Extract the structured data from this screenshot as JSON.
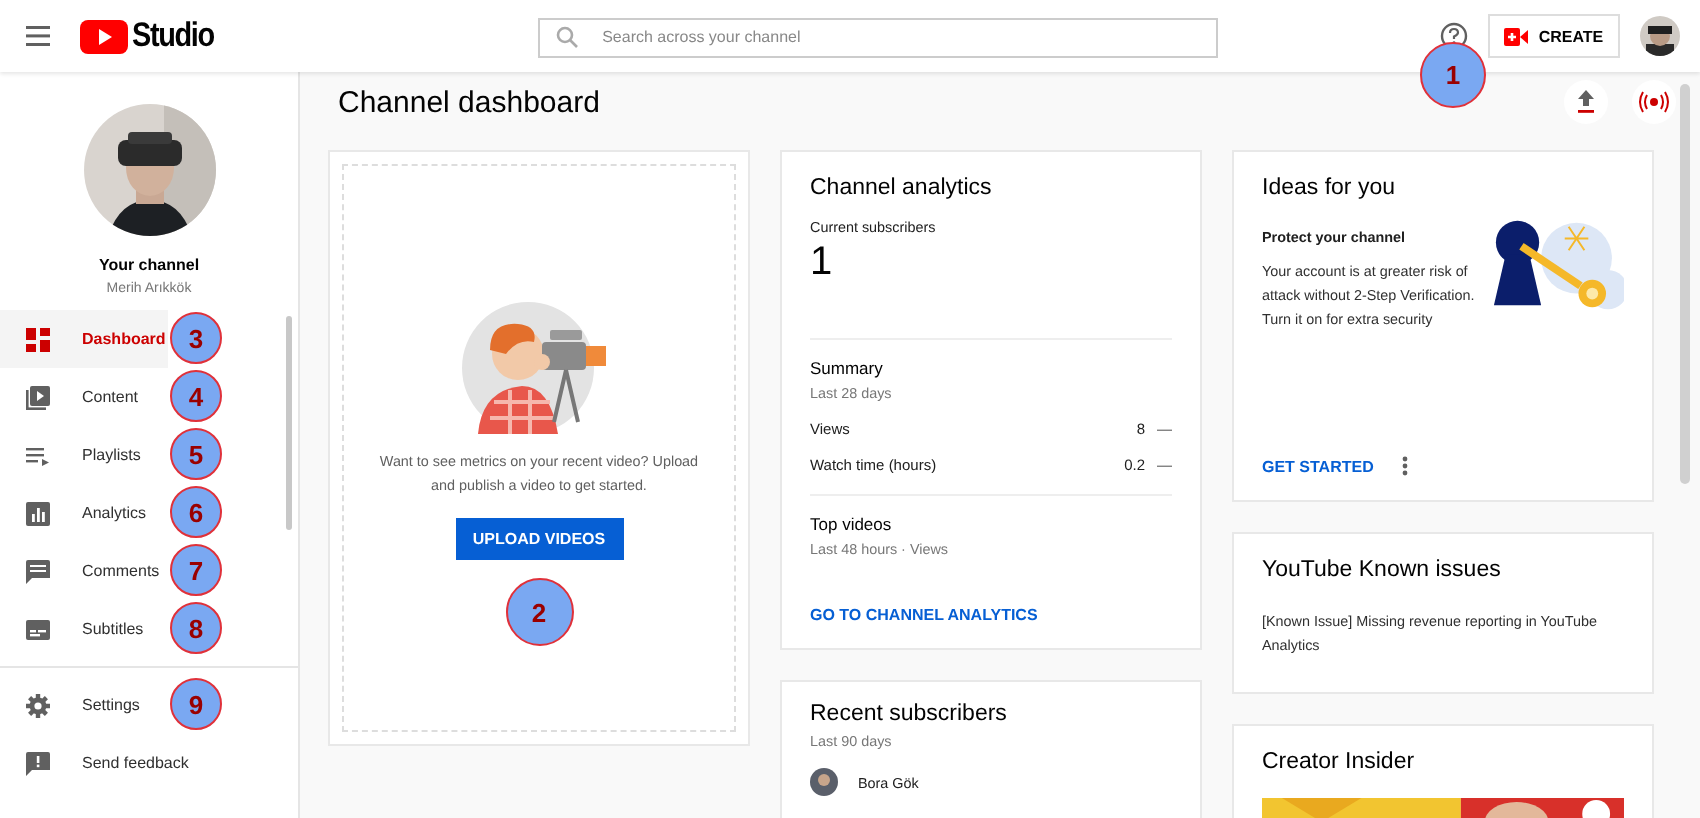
{
  "header": {
    "logo_text": "Studio",
    "search_placeholder": "Search across your channel",
    "help_marker": "1",
    "create_label": "CREATE"
  },
  "sidebar": {
    "channel_title": "Your channel",
    "channel_name": "Merih Arıkkök",
    "items": [
      {
        "kind": "dashboard",
        "label": "Dashboard",
        "selected": true,
        "marker": "3"
      },
      {
        "kind": "content",
        "label": "Content",
        "selected": false,
        "marker": "4"
      },
      {
        "kind": "playlists",
        "label": "Playlists",
        "selected": false,
        "marker": "5"
      },
      {
        "kind": "analytics",
        "label": "Analytics",
        "selected": false,
        "marker": "6"
      },
      {
        "kind": "comments",
        "label": "Comments",
        "selected": false,
        "marker": "7"
      },
      {
        "kind": "subtitles",
        "label": "Subtitles",
        "selected": false,
        "marker": "8"
      }
    ],
    "footer_items": [
      {
        "kind": "settings",
        "label": "Settings",
        "marker": "9"
      },
      {
        "kind": "feedback",
        "label": "Send feedback"
      }
    ]
  },
  "page_title": "Channel dashboard",
  "upload_card": {
    "text": "Want to see metrics on your recent video? Upload and publish a video to get started.",
    "button": "UPLOAD VIDEOS",
    "button_marker": "2"
  },
  "analytics_card": {
    "title": "Channel analytics",
    "subscribers_label": "Current subscribers",
    "subscribers": "1",
    "summary_title": "Summary",
    "summary_period": "Last 28 days",
    "metrics": [
      {
        "label": "Views",
        "value": "8",
        "trend": "—"
      },
      {
        "label": "Watch time (hours)",
        "value": "0.2",
        "trend": "—"
      }
    ],
    "top_title": "Top videos",
    "top_period": "Last 48 hours · Views",
    "link": "GO TO CHANNEL ANALYTICS"
  },
  "recent_card": {
    "title": "Recent subscribers",
    "period": "Last 90 days",
    "subscribers": [
      "Bora Gök"
    ]
  },
  "ideas_card": {
    "title": "Ideas for you",
    "subtitle": "Protect your channel",
    "text": "Your account is at greater risk of attack without 2-Step Verification. Turn it on for extra security",
    "link": "GET STARTED"
  },
  "issues_card": {
    "title": "YouTube Known issues",
    "text": "[Known Issue] Missing revenue reporting in YouTube Analytics"
  },
  "insider_card": {
    "title": "Creator Insider"
  }
}
